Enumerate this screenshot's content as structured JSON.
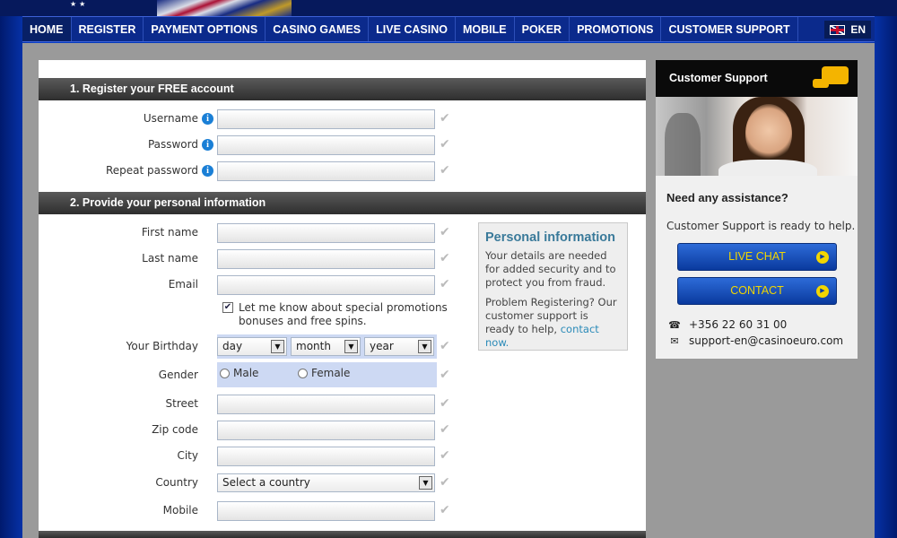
{
  "nav": {
    "items": [
      "HOME",
      "REGISTER",
      "PAYMENT OPTIONS",
      "CASINO GAMES",
      "LIVE CASINO",
      "MOBILE",
      "POKER",
      "PROMOTIONS",
      "CUSTOMER SUPPORT"
    ],
    "language": "EN"
  },
  "section1": {
    "title": "1. Register your FREE account",
    "fields": {
      "username": "Username",
      "password": "Password",
      "repeat_password": "Repeat password"
    }
  },
  "section2": {
    "title": "2. Provide your personal information",
    "fields": {
      "first_name": "First name",
      "last_name": "Last name",
      "email": "Email",
      "birthday": "Your Birthday",
      "gender": "Gender",
      "street": "Street",
      "zip": "Zip code",
      "city": "City",
      "country": "Country",
      "mobile": "Mobile"
    },
    "promo_text": "Let me know about special promotions bonuses and free spins.",
    "birthday_selects": {
      "day": "day",
      "month": "month",
      "year": "year"
    },
    "gender_options": {
      "male": "Male",
      "female": "Female"
    },
    "country_select": "Select a country"
  },
  "personal_info": {
    "title": "Personal information",
    "p1": "Your details are needed for added security and to protect you from fraud.",
    "p2": "Problem Registering? Our customer support is ready to help,",
    "link": "contact now."
  },
  "support": {
    "title": "Customer Support",
    "help_title": "Need any assistance?",
    "help_sub": "Customer Support is ready to help.",
    "live_chat": "LIVE CHAT",
    "contact": "CONTACT",
    "phone": "+356 22 60 31 00",
    "email": "support-en@casinoeuro.com"
  }
}
